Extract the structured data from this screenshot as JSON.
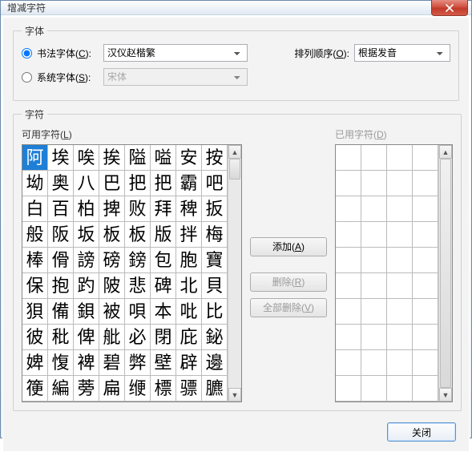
{
  "window": {
    "title": "增减字符"
  },
  "font_group": {
    "legend": "字体",
    "calli_label_pre": "书法字体(",
    "calli_hotkey": "C",
    "calli_label_post": "):",
    "calli_value": "汉仪赵楷繁",
    "sys_label_pre": "系统字体(",
    "sys_hotkey": "S",
    "sys_label_post": "):",
    "sys_value": "宋体",
    "sort_label_pre": "排列顺序(",
    "sort_hotkey": "O",
    "sort_label_post": "):",
    "sort_value": "根据发音"
  },
  "char_group": {
    "legend": "字符"
  },
  "available": {
    "label_pre": "可用字符(",
    "hotkey": "L",
    "label_post": ")",
    "selected_index": 0,
    "cells": [
      "阿",
      "埃",
      "唉",
      "挨",
      "隘",
      "嗌",
      "安",
      "按",
      "坳",
      "奥",
      "八",
      "巴",
      "把",
      "把",
      "霸",
      "吧",
      "白",
      "百",
      "柏",
      "捭",
      "败",
      "拜",
      "稗",
      "扳",
      "般",
      "阪",
      "坂",
      "板",
      "板",
      "版",
      "拌",
      "梅",
      "棒",
      "傦",
      "謗",
      "磅",
      "鎊",
      "包",
      "胞",
      "寶",
      "保",
      "抱",
      "趵",
      "陂",
      "悲",
      "碑",
      "北",
      "貝",
      "狽",
      "備",
      "鋇",
      "被",
      "唄",
      "本",
      "吡",
      "比",
      "彼",
      "秕",
      "俾",
      "舭",
      "必",
      "閉",
      "庇",
      "鉍",
      "婢",
      "愎",
      "裨",
      "碧",
      "弊",
      "壁",
      "辟",
      "邊",
      "箯",
      "編",
      "蒡",
      "扁",
      "缏",
      "標",
      "骠",
      "臕"
    ]
  },
  "used": {
    "label_pre": "已用字符(",
    "hotkey": "D",
    "label_post": ")",
    "rows": 10
  },
  "buttons": {
    "add_pre": "添加(",
    "add_hot": "A",
    "add_post": ")",
    "remove_pre": "删除(",
    "remove_hot": "R",
    "remove_post": ")",
    "remove_all_pre": "全部删除(",
    "remove_all_hot": "V",
    "remove_all_post": ")",
    "close": "关闭"
  }
}
